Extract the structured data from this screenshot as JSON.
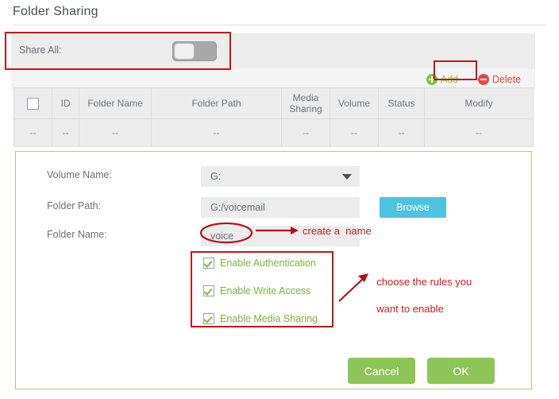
{
  "page": {
    "title": "Folder Sharing"
  },
  "share_all": {
    "label": "Share All:",
    "toggle_state": "off"
  },
  "toolbar": {
    "add_label": "Add",
    "delete_label": "Delete",
    "add_icon": "plus-circle-icon",
    "delete_icon": "minus-circle-icon",
    "add_color": "#8dc63f",
    "delete_color": "#e8453c"
  },
  "table": {
    "headers": {
      "select_all": "",
      "id": "ID",
      "folder_name": "Folder Name",
      "folder_path": "Folder Path",
      "media_sharing_line1": "Media",
      "media_sharing_line2": "Sharing",
      "volume": "Volume",
      "status": "Status",
      "modify": "Modify"
    },
    "rows": [
      {
        "select": "--",
        "id": "--",
        "folder_name": "--",
        "folder_path": "--",
        "media_sharing": "--",
        "volume": "--",
        "status": "--",
        "modify": "--"
      }
    ]
  },
  "form": {
    "volume_name_label": "Volume Name:",
    "volume_name_value": "G:",
    "folder_path_label": "Folder Path:",
    "folder_path_value": "G:/voicemail",
    "folder_name_label": "Folder Name:",
    "folder_name_value": "voice",
    "browse_label": "Browse",
    "browse_color": "#4ec3e0",
    "checkboxes": [
      {
        "label": "Enable Authentication",
        "checked": true
      },
      {
        "label": "Enable Write Access",
        "checked": true
      },
      {
        "label": "Enable Media Sharing",
        "checked": true
      }
    ],
    "cancel_label": "Cancel",
    "ok_label": "OK",
    "button_color": "#8dc556",
    "panel_border_color": "#a8cf72"
  },
  "annotations": {
    "color": "#c4161c",
    "create_name_text": "create a  name",
    "choose_rules_line1": "choose the rules you",
    "choose_rules_line2": "want to enable"
  }
}
